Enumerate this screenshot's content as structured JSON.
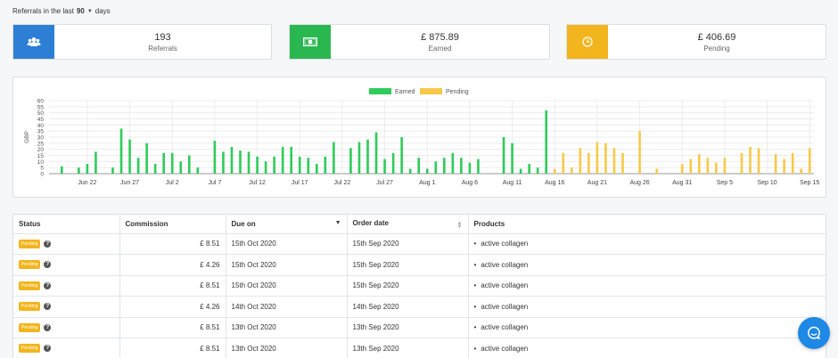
{
  "header": {
    "prefix": "Referrals in the last",
    "days": "90"
  },
  "stats": [
    {
      "icon": "users-icon",
      "value": "193",
      "label": "Referrals",
      "color": "#2d7fd6"
    },
    {
      "icon": "money-icon",
      "value": "£ 875.89",
      "label": "Earned",
      "color": "#2bb750"
    },
    {
      "icon": "clock-icon",
      "value": "£ 406.69",
      "label": "Pending",
      "color": "#f3b51d"
    }
  ],
  "chart_data": {
    "type": "bar",
    "ylabel": "GBP",
    "ylim": [
      0,
      60
    ],
    "yticks": [
      0,
      5,
      10,
      15,
      20,
      25,
      30,
      35,
      40,
      45,
      50,
      55,
      60
    ],
    "legend": [
      "Earned",
      "Pending"
    ],
    "colors": {
      "Earned": "#2ecc5a",
      "Pending": "#f7c948"
    },
    "xtick_labels": [
      "Jun 22",
      "Jun 27",
      "Jul 2",
      "Jul 7",
      "Jul 12",
      "Jul 17",
      "Jul 22",
      "Jul 27",
      "Aug 1",
      "Aug 6",
      "Aug 11",
      "Aug 16",
      "Aug 21",
      "Aug 26",
      "Aug 31",
      "Sep 5",
      "Sep 10",
      "Sep 15"
    ],
    "xtick_index": [
      5,
      10,
      15,
      20,
      25,
      30,
      35,
      40,
      45,
      50,
      55,
      60,
      65,
      70,
      75,
      80,
      85,
      90
    ],
    "earned": [
      0,
      6,
      0,
      5,
      8,
      18,
      0,
      5,
      37,
      28,
      13,
      25,
      8,
      17,
      17,
      10,
      15,
      5,
      0,
      27,
      18,
      22,
      19,
      18,
      14,
      10,
      14,
      22,
      22,
      14,
      13,
      8,
      14,
      26,
      0,
      21,
      26,
      28,
      34,
      12,
      17,
      30,
      4,
      13,
      4,
      10,
      13,
      17,
      13,
      9,
      12,
      0,
      0,
      30,
      25,
      4,
      8,
      5,
      52,
      0,
      0,
      0,
      0,
      0,
      0,
      0,
      0,
      0,
      0,
      0,
      0,
      0,
      0,
      0,
      0,
      0,
      0,
      0,
      0,
      0,
      0,
      0,
      0,
      0,
      0,
      0,
      0,
      0,
      0,
      0
    ],
    "pending": [
      0,
      0,
      0,
      0,
      0,
      0,
      0,
      0,
      0,
      0,
      0,
      0,
      0,
      0,
      0,
      0,
      0,
      0,
      0,
      0,
      0,
      0,
      0,
      0,
      0,
      0,
      0,
      0,
      0,
      0,
      0,
      0,
      0,
      0,
      0,
      0,
      0,
      0,
      0,
      0,
      0,
      0,
      0,
      0,
      0,
      0,
      0,
      0,
      0,
      0,
      0,
      0,
      0,
      0,
      0,
      0,
      0,
      0,
      0,
      4,
      17,
      5,
      21,
      17,
      26,
      25,
      21,
      17,
      0,
      35,
      0,
      4,
      0,
      0,
      8,
      12,
      16,
      13,
      9,
      13,
      0,
      17,
      22,
      21,
      0,
      16,
      12,
      17,
      4,
      21
    ]
  },
  "table": {
    "columns": [
      "Status",
      "Commission",
      "Due on",
      "Order date",
      "Products"
    ],
    "rows": [
      {
        "status": "Pending",
        "commission": "£ 8.51",
        "due": "15th Oct 2020",
        "order": "15th Sep 2020",
        "product": "active collagen"
      },
      {
        "status": "Pending",
        "commission": "£ 4.26",
        "due": "15th Oct 2020",
        "order": "15th Sep 2020",
        "product": "active collagen"
      },
      {
        "status": "Pending",
        "commission": "£ 8.51",
        "due": "15th Oct 2020",
        "order": "15th Sep 2020",
        "product": "active collagen"
      },
      {
        "status": "Pending",
        "commission": "£ 4.26",
        "due": "14th Oct 2020",
        "order": "14th Sep 2020",
        "product": "active collagen"
      },
      {
        "status": "Pending",
        "commission": "£ 8.51",
        "due": "13th Oct 2020",
        "order": "13th Sep 2020",
        "product": "active collagen"
      },
      {
        "status": "Pending",
        "commission": "£ 8.51",
        "due": "13th Oct 2020",
        "order": "13th Sep 2020",
        "product": "active collagen"
      }
    ]
  },
  "chat": {
    "icon": "chat-bubble-icon"
  }
}
